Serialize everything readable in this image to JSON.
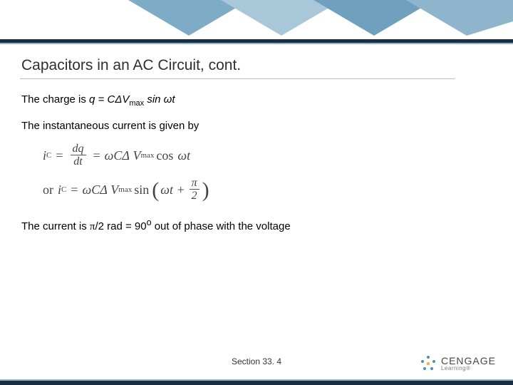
{
  "header": {
    "accent_dark": "#1b2f3f",
    "accent_light": "#8fb5cc"
  },
  "title": "Capacitors in an AC Circuit, cont.",
  "body": {
    "charge_prefix": "The charge is ",
    "charge_eq_lead": "q = CΔV",
    "charge_eq_sub": "max",
    "charge_eq_tail": " sin ωt",
    "current_intro": "The instantaneous current is given by",
    "eq1": {
      "lhs_i": "i",
      "lhs_sub": "C",
      "frac_num": "dq",
      "frac_den": "dt",
      "rhs_a": "ωCΔ",
      "rhs_v": "V",
      "rhs_vmax": "max",
      "rhs_cos": "cos",
      "rhs_arg": "ωt"
    },
    "eq2": {
      "or": "or",
      "lhs_i": "i",
      "lhs_sub": "C",
      "rhs_a": "ωCΔ",
      "rhs_v": "V",
      "rhs_vmax": "max",
      "rhs_sin": "sin",
      "arg_lead": "ωt +",
      "frac_num": "π",
      "frac_den": "2"
    },
    "phase_a": "The current is ",
    "phase_pi": "π",
    "phase_b": "/2 rad = 90",
    "phase_sup": "o",
    "phase_c": " out of phase with the voltage"
  },
  "section_label": "Section  33. 4",
  "logo": {
    "brand": "CENGAGE",
    "tag": "Learning®"
  }
}
